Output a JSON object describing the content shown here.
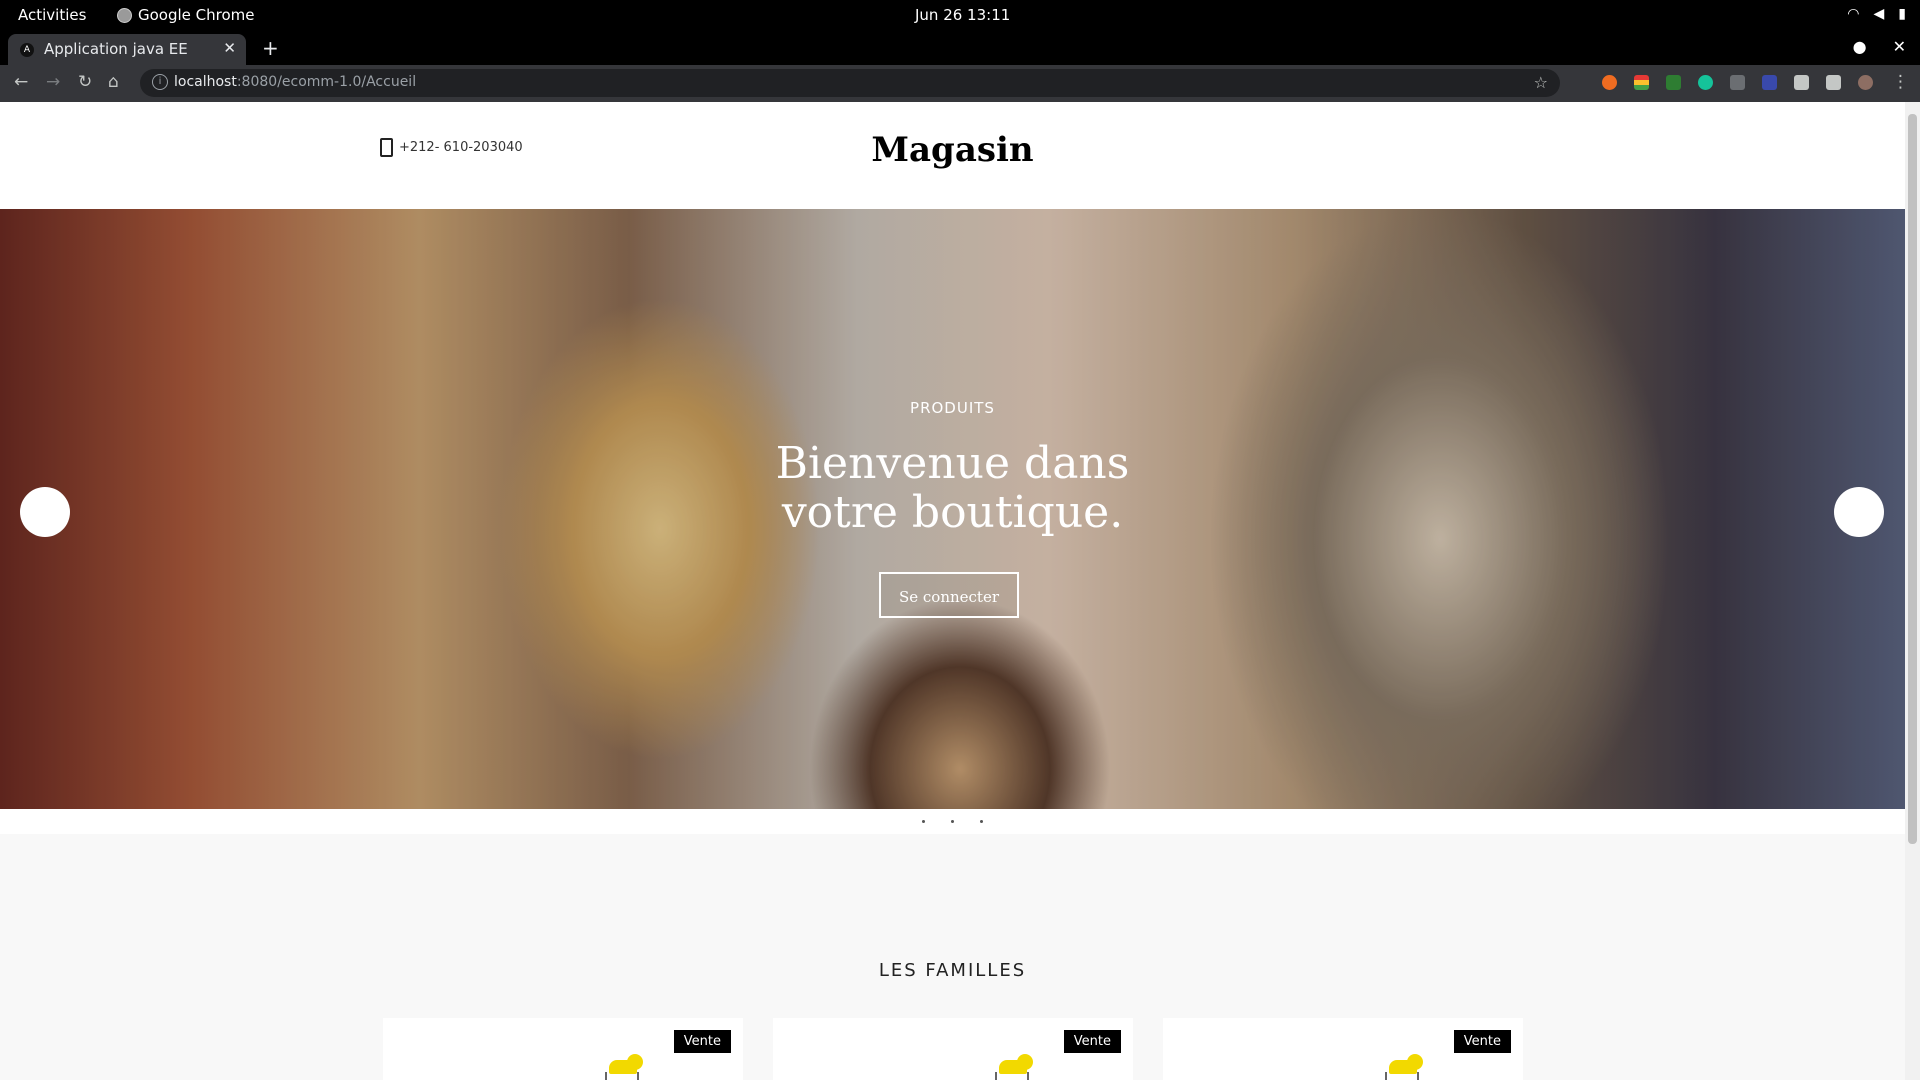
{
  "system": {
    "activities": "Activities",
    "app_name": "Google Chrome",
    "clock": "Jun 26  13:11"
  },
  "browser": {
    "tab_title": "Application java EE",
    "tab_icon_letter": "A",
    "url_host": "localhost",
    "url_rest": ":8080/ecomm-1.0/Accueil"
  },
  "header": {
    "phone": "+212- 610-203040",
    "brand": "Magasin"
  },
  "hero": {
    "eyebrow": "PRODUITS",
    "headline_line1": "Bienvenue dans",
    "headline_line2": "votre boutique.",
    "cta": "Se connecter"
  },
  "families": {
    "heading": "LES FAMILLES",
    "cards": [
      {
        "badge": "Vente"
      },
      {
        "badge": "Vente"
      },
      {
        "badge": "Vente"
      }
    ]
  },
  "colors": {
    "accent": "#000000",
    "badge_bg": "#000000",
    "section_bg": "#f8f8f8"
  }
}
